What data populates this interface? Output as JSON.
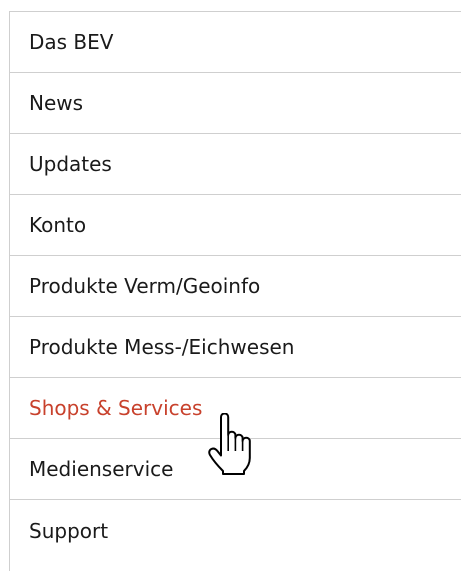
{
  "menu": {
    "items": [
      {
        "label": "Das BEV"
      },
      {
        "label": "News"
      },
      {
        "label": "Updates"
      },
      {
        "label": "Konto"
      },
      {
        "label": "Produkte Verm/Geoinfo"
      },
      {
        "label": "Produkte Mess-/Eichwesen"
      },
      {
        "label": "Shops & Services"
      },
      {
        "label": "Medienservice"
      },
      {
        "label": "Support"
      }
    ],
    "hovered_item": "Shops & Services"
  },
  "colors": {
    "text": "#1a1a1a",
    "hover_text": "#c8412c",
    "divider": "#cfcfcf",
    "background": "#ffffff"
  },
  "cursor": {
    "icon": "hand-pointer-icon"
  }
}
